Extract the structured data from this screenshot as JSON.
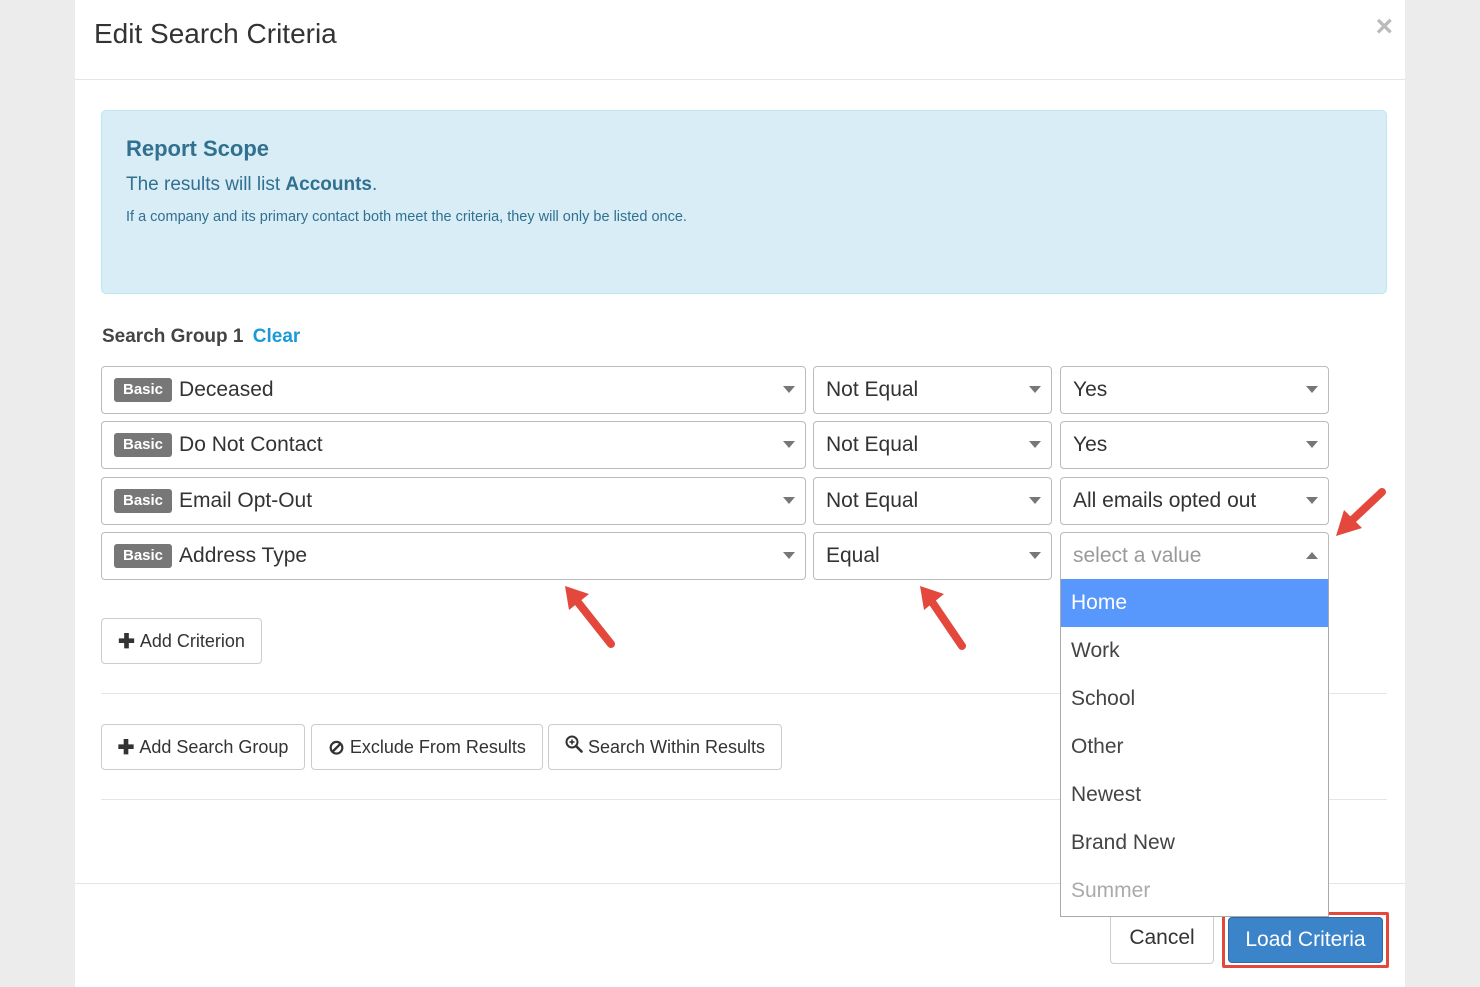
{
  "modal": {
    "title": "Edit Search Criteria",
    "close_glyph": "×"
  },
  "scope": {
    "title": "Report Scope",
    "line_prefix": "The results will list ",
    "line_bold": "Accounts",
    "line_suffix": ".",
    "note": "If a company and its primary contact both meet the criteria, they will only be listed once."
  },
  "group": {
    "label": "Search Group 1",
    "clear": "Clear"
  },
  "criteria": [
    {
      "badge": "Basic",
      "field": "Deceased",
      "operator": "Not Equal",
      "value": "Yes"
    },
    {
      "badge": "Basic",
      "field": "Do Not Contact",
      "operator": "Not Equal",
      "value": "Yes"
    },
    {
      "badge": "Basic",
      "field": "Email Opt-Out",
      "operator": "Not Equal",
      "value": "All emails opted out"
    },
    {
      "badge": "Basic",
      "field": "Address Type",
      "operator": "Equal",
      "value_placeholder": "select a value"
    }
  ],
  "buttons": {
    "add_criterion": "Add Criterion",
    "add_search_group": "Add Search Group",
    "exclude_from_results": "Exclude From Results",
    "search_within_results": "Search Within Results",
    "cancel": "Cancel",
    "load_criteria": "Load Criteria"
  },
  "dropdown": {
    "options": [
      "Home",
      "Work",
      "School",
      "Other",
      "Newest",
      "Brand New",
      "Summer"
    ],
    "highlighted": "Home"
  },
  "colors": {
    "highlight": "#5897fb",
    "primary": "#3c84c9",
    "annotation": "#e4473c"
  },
  "icons": {
    "plus": "plus-icon",
    "ban": "ban-icon",
    "search_plus": "zoom-in-icon",
    "close": "close-icon",
    "caret": "caret-down-icon"
  }
}
